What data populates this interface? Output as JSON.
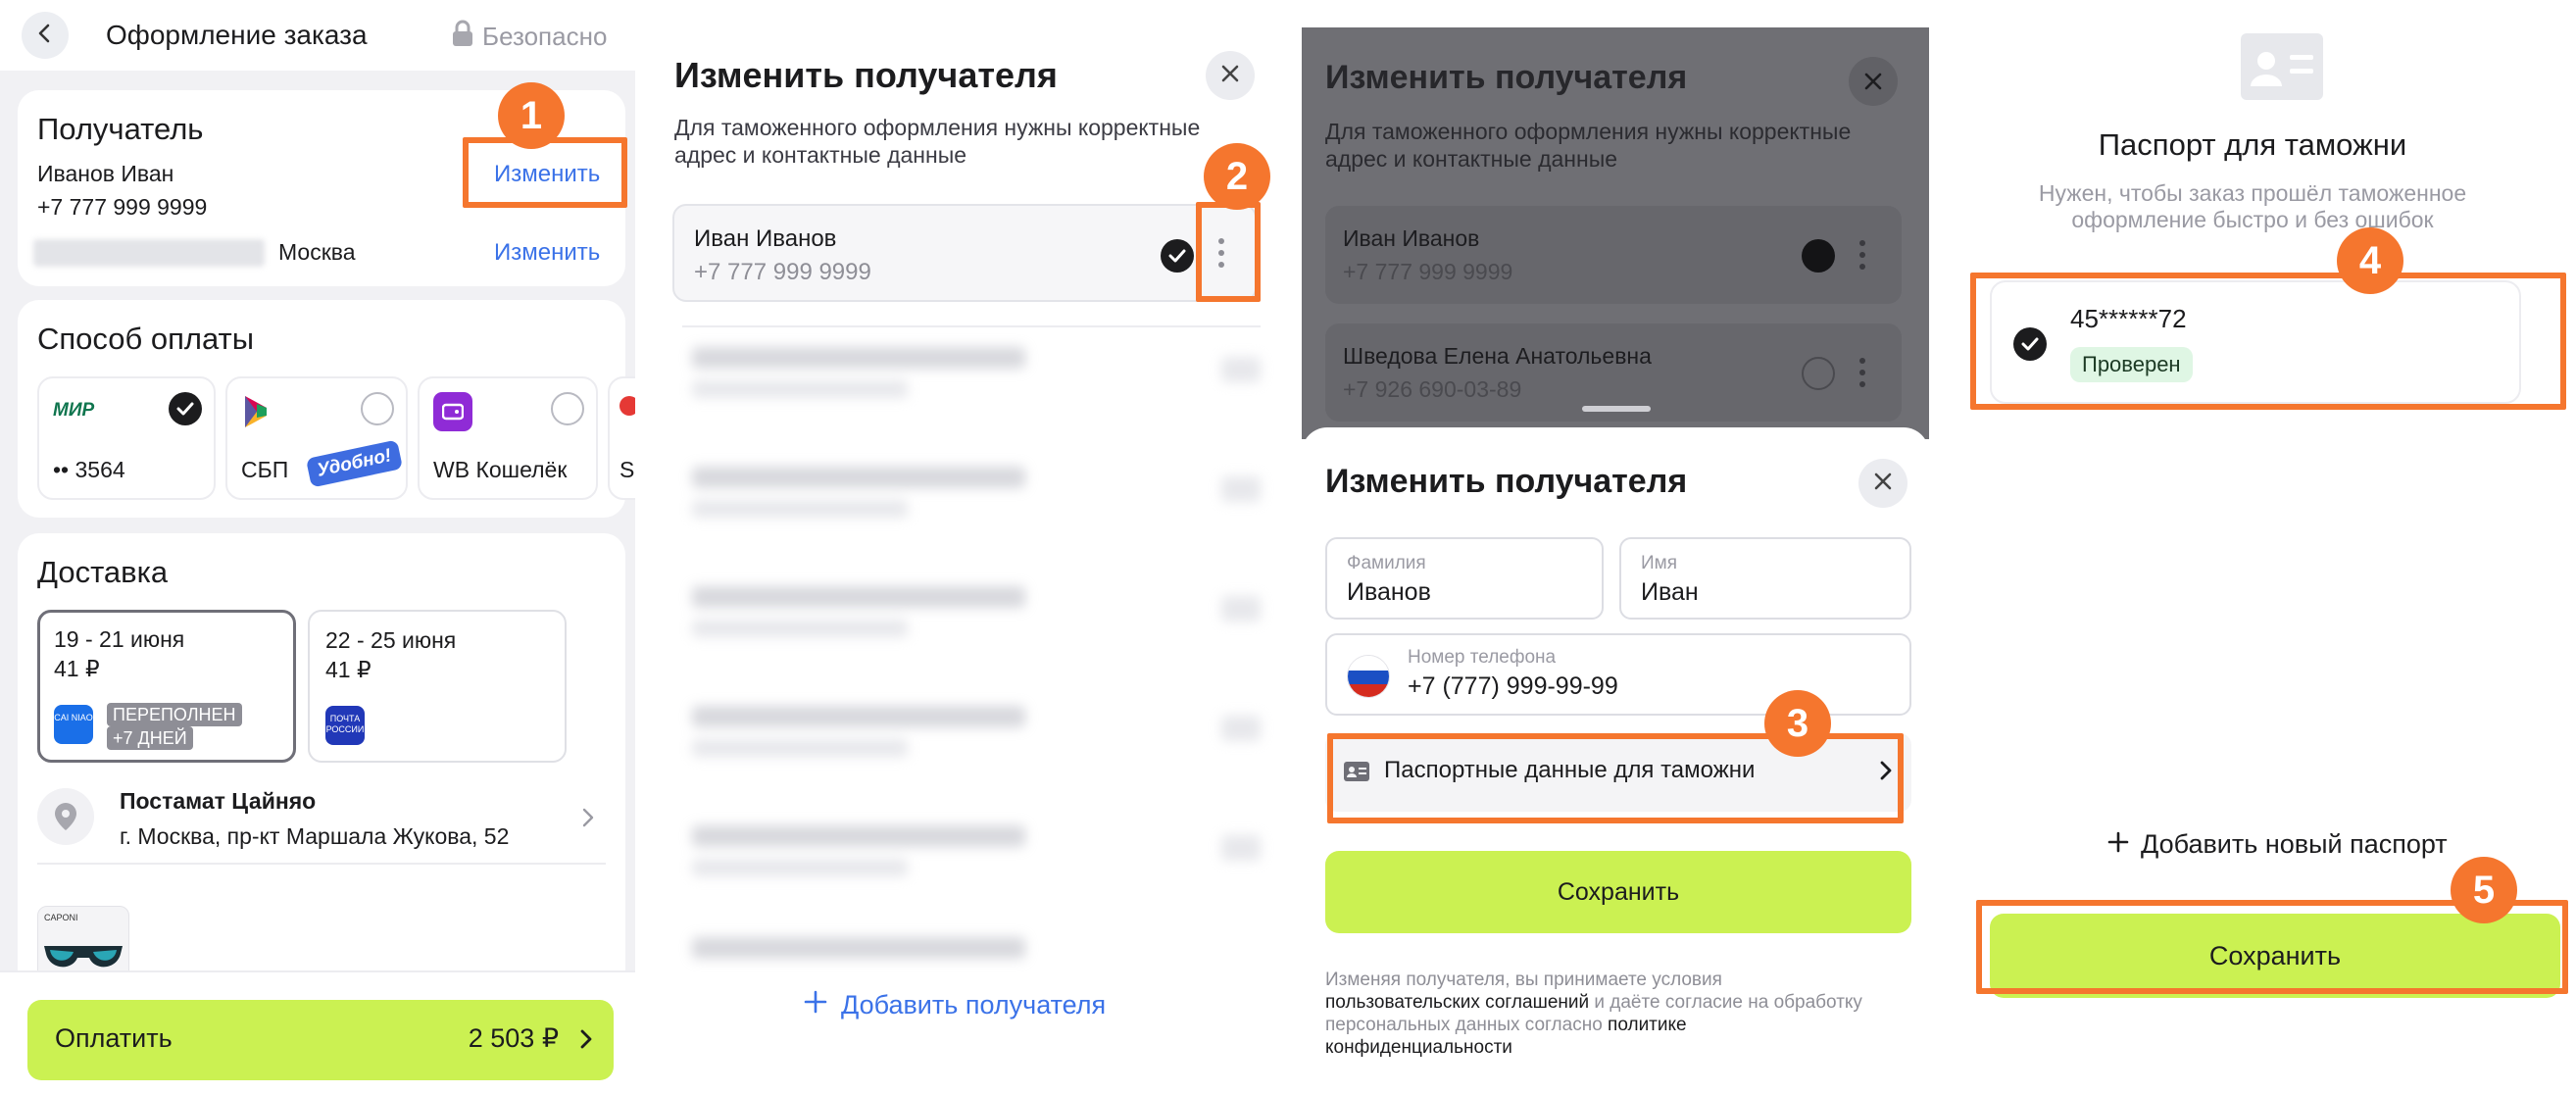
{
  "panel1": {
    "title": "Оформление заказа",
    "secure": "Безопасно",
    "recipient": {
      "heading": "Получатель",
      "name": "Иванов Иван",
      "phone": "+7 777 999 9999",
      "change": "Изменить",
      "city": "Москва",
      "change2": "Изменить"
    },
    "payment": {
      "heading": "Способ оплаты",
      "items": [
        {
          "logo": "МИР",
          "label": "•• 3564",
          "selected": true
        },
        {
          "logo": "СБП",
          "label": "СБП",
          "promo": "Удобно!",
          "selected": false
        },
        {
          "logo": "WB",
          "label": "WB Кошелёк",
          "selected": false
        },
        {
          "label": "S"
        }
      ]
    },
    "delivery": {
      "heading": "Доставка",
      "options": [
        {
          "dates": "19 - 21 июня",
          "price": "41 ₽",
          "logo": "CAI NIAO",
          "badge_line1": "ПЕРЕПОЛНЕН",
          "badge_line2": "+7 ДНЕЙ",
          "selected": true
        },
        {
          "dates": "22 - 25 июня",
          "price": "41 ₽",
          "logo": "ПОЧТА РОССИИ",
          "selected": false
        }
      ],
      "pickup_title": "Постамат Цайняо",
      "pickup_address": "г. Москва, пр-кт Маршала Жукова, 52",
      "product_brand": "CAPONI"
    },
    "pay_button": {
      "label": "Оплатить",
      "amount": "2 503 ₽"
    }
  },
  "panel2": {
    "title": "Изменить получателя",
    "subtitle_line1": "Для таможенного оформления нужны корректные",
    "subtitle_line2": "адрес и контактные данные",
    "recipient": {
      "name": "Иван Иванов",
      "phone": "+7 777 999 9999",
      "selected": true
    },
    "add_recipient": "Добавить получателя"
  },
  "panel3": {
    "bg_title": "Изменить получателя",
    "bg_subtitle_line1": "Для таможенного оформления нужны корректные",
    "bg_subtitle_line2": "адрес и контактные данные",
    "bg_recipients": [
      {
        "name": "Иван Иванов",
        "phone": "+7 777 999 9999",
        "selected": true
      },
      {
        "name": "Шведова Елена Анатольевна",
        "phone": "+7 926 690-03-89",
        "selected": false
      }
    ],
    "sheet": {
      "title": "Изменить получателя",
      "lastname_label": "Фамилия",
      "lastname_value": "Иванов",
      "firstname_label": "Имя",
      "firstname_value": "Иван",
      "phone_label": "Номер телефона",
      "phone_value": "+7 (777) 999-99-99",
      "passport_row": "Паспортные данные для таможни",
      "save": "Сохранить",
      "legal_1": "Изменяя получателя, вы принимаете условия",
      "legal_2a": "пользовательских соглашений",
      "legal_2b": " и даёте согласие на обработку",
      "legal_3": "персональных данных согласно ",
      "legal_3b": "политике",
      "legal_4": "конфиденциальности"
    }
  },
  "panel4": {
    "title": "Паспорт для таможни",
    "subtitle_line1": "Нужен, чтобы заказ прошёл таможенное",
    "subtitle_line2": "оформление быстро и без ошибок",
    "passport": {
      "number": "45******72",
      "status": "Проверен",
      "selected": true
    },
    "add_passport": "Добавить новый паспорт",
    "save": "Сохранить"
  },
  "steps": [
    "1",
    "2",
    "3",
    "4",
    "5"
  ],
  "colors": {
    "accent_green": "#cbf152",
    "link_blue": "#3b72e8",
    "annotation_orange": "#f5762e",
    "verified_bg": "#dff6e4"
  }
}
